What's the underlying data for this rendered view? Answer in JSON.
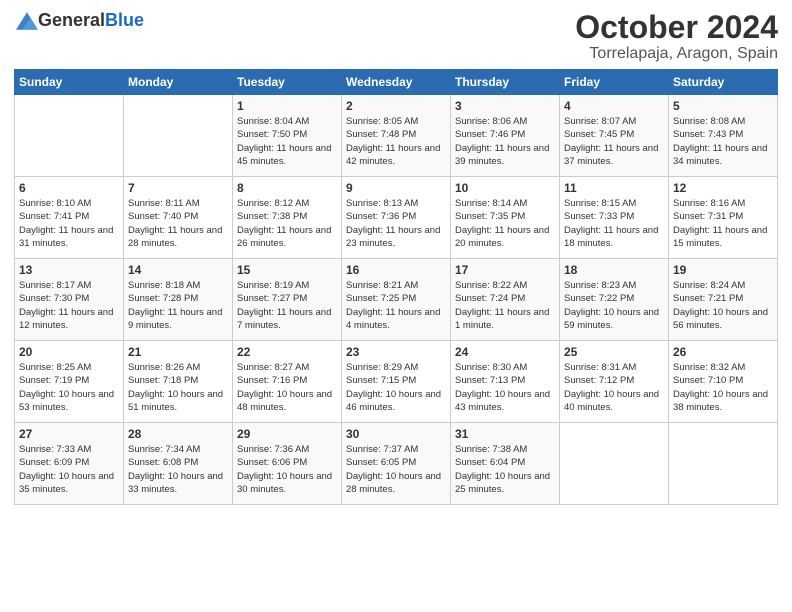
{
  "header": {
    "logo_general": "General",
    "logo_blue": "Blue",
    "month": "October 2024",
    "location": "Torrelapaja, Aragon, Spain"
  },
  "days_of_week": [
    "Sunday",
    "Monday",
    "Tuesday",
    "Wednesday",
    "Thursday",
    "Friday",
    "Saturday"
  ],
  "weeks": [
    [
      {
        "day": "",
        "info": ""
      },
      {
        "day": "",
        "info": ""
      },
      {
        "day": "1",
        "info": "Sunrise: 8:04 AM\nSunset: 7:50 PM\nDaylight: 11 hours and 45 minutes."
      },
      {
        "day": "2",
        "info": "Sunrise: 8:05 AM\nSunset: 7:48 PM\nDaylight: 11 hours and 42 minutes."
      },
      {
        "day": "3",
        "info": "Sunrise: 8:06 AM\nSunset: 7:46 PM\nDaylight: 11 hours and 39 minutes."
      },
      {
        "day": "4",
        "info": "Sunrise: 8:07 AM\nSunset: 7:45 PM\nDaylight: 11 hours and 37 minutes."
      },
      {
        "day": "5",
        "info": "Sunrise: 8:08 AM\nSunset: 7:43 PM\nDaylight: 11 hours and 34 minutes."
      }
    ],
    [
      {
        "day": "6",
        "info": "Sunrise: 8:10 AM\nSunset: 7:41 PM\nDaylight: 11 hours and 31 minutes."
      },
      {
        "day": "7",
        "info": "Sunrise: 8:11 AM\nSunset: 7:40 PM\nDaylight: 11 hours and 28 minutes."
      },
      {
        "day": "8",
        "info": "Sunrise: 8:12 AM\nSunset: 7:38 PM\nDaylight: 11 hours and 26 minutes."
      },
      {
        "day": "9",
        "info": "Sunrise: 8:13 AM\nSunset: 7:36 PM\nDaylight: 11 hours and 23 minutes."
      },
      {
        "day": "10",
        "info": "Sunrise: 8:14 AM\nSunset: 7:35 PM\nDaylight: 11 hours and 20 minutes."
      },
      {
        "day": "11",
        "info": "Sunrise: 8:15 AM\nSunset: 7:33 PM\nDaylight: 11 hours and 18 minutes."
      },
      {
        "day": "12",
        "info": "Sunrise: 8:16 AM\nSunset: 7:31 PM\nDaylight: 11 hours and 15 minutes."
      }
    ],
    [
      {
        "day": "13",
        "info": "Sunrise: 8:17 AM\nSunset: 7:30 PM\nDaylight: 11 hours and 12 minutes."
      },
      {
        "day": "14",
        "info": "Sunrise: 8:18 AM\nSunset: 7:28 PM\nDaylight: 11 hours and 9 minutes."
      },
      {
        "day": "15",
        "info": "Sunrise: 8:19 AM\nSunset: 7:27 PM\nDaylight: 11 hours and 7 minutes."
      },
      {
        "day": "16",
        "info": "Sunrise: 8:21 AM\nSunset: 7:25 PM\nDaylight: 11 hours and 4 minutes."
      },
      {
        "day": "17",
        "info": "Sunrise: 8:22 AM\nSunset: 7:24 PM\nDaylight: 11 hours and 1 minute."
      },
      {
        "day": "18",
        "info": "Sunrise: 8:23 AM\nSunset: 7:22 PM\nDaylight: 10 hours and 59 minutes."
      },
      {
        "day": "19",
        "info": "Sunrise: 8:24 AM\nSunset: 7:21 PM\nDaylight: 10 hours and 56 minutes."
      }
    ],
    [
      {
        "day": "20",
        "info": "Sunrise: 8:25 AM\nSunset: 7:19 PM\nDaylight: 10 hours and 53 minutes."
      },
      {
        "day": "21",
        "info": "Sunrise: 8:26 AM\nSunset: 7:18 PM\nDaylight: 10 hours and 51 minutes."
      },
      {
        "day": "22",
        "info": "Sunrise: 8:27 AM\nSunset: 7:16 PM\nDaylight: 10 hours and 48 minutes."
      },
      {
        "day": "23",
        "info": "Sunrise: 8:29 AM\nSunset: 7:15 PM\nDaylight: 10 hours and 46 minutes."
      },
      {
        "day": "24",
        "info": "Sunrise: 8:30 AM\nSunset: 7:13 PM\nDaylight: 10 hours and 43 minutes."
      },
      {
        "day": "25",
        "info": "Sunrise: 8:31 AM\nSunset: 7:12 PM\nDaylight: 10 hours and 40 minutes."
      },
      {
        "day": "26",
        "info": "Sunrise: 8:32 AM\nSunset: 7:10 PM\nDaylight: 10 hours and 38 minutes."
      }
    ],
    [
      {
        "day": "27",
        "info": "Sunrise: 7:33 AM\nSunset: 6:09 PM\nDaylight: 10 hours and 35 minutes."
      },
      {
        "day": "28",
        "info": "Sunrise: 7:34 AM\nSunset: 6:08 PM\nDaylight: 10 hours and 33 minutes."
      },
      {
        "day": "29",
        "info": "Sunrise: 7:36 AM\nSunset: 6:06 PM\nDaylight: 10 hours and 30 minutes."
      },
      {
        "day": "30",
        "info": "Sunrise: 7:37 AM\nSunset: 6:05 PM\nDaylight: 10 hours and 28 minutes."
      },
      {
        "day": "31",
        "info": "Sunrise: 7:38 AM\nSunset: 6:04 PM\nDaylight: 10 hours and 25 minutes."
      },
      {
        "day": "",
        "info": ""
      },
      {
        "day": "",
        "info": ""
      }
    ]
  ]
}
